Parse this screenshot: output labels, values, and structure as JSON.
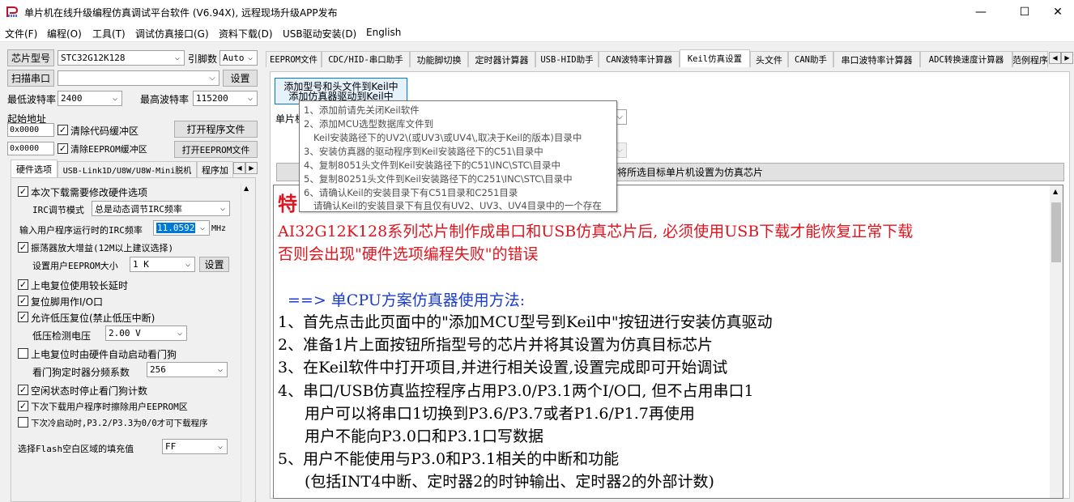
{
  "window": {
    "title": "单片机在线升级编程仿真调试平台软件 (V6.94X), 远程现场升级APP发布",
    "minimize": "—",
    "maximize": "☐",
    "close": "✕"
  },
  "menu": [
    "文件(F)",
    "编程(O)",
    "工具(T)",
    "调试仿真接口(G)",
    "资料下载(D)",
    "USB驱动安装(D)",
    "English"
  ],
  "left": {
    "chip_type_btn": "芯片型号",
    "chip_value": "STC32G12K128",
    "pin_label": "引脚数",
    "pin_value": "Auto",
    "scan_btn": "扫描串口",
    "port_value": "",
    "settings_btn": "设置",
    "min_baud_label": "最低波特率",
    "min_baud_value": "2400",
    "max_baud_label": "最高波特率",
    "max_baud_value": "115200",
    "start_addr_label": "起始地址",
    "addr1": "0x0000",
    "clear_code_label": "清除代码缓冲区",
    "open_prog_btn": "打开程序文件",
    "addr2": "0x0000",
    "clear_eeprom_label": "清除EEPROM缓冲区",
    "open_eeprom_btn": "打开EEPROM文件"
  },
  "left_tabs": [
    "硬件选项",
    "USB-Link1D/U8W/U8W-Mini脱机",
    "程序加"
  ],
  "hw": {
    "opt_modify": "本次下载需要修改硬件选项",
    "irc_mode_label": "IRC调节模式",
    "irc_mode_value": "总是动态调节IRC频率",
    "irc_freq_label": "输入用户程序运行时的IRC频率",
    "irc_freq_value": "11.0592",
    "irc_freq_unit": "MHz",
    "opt_osc_gain": "振荡器放大增益(12M以上建议选择)",
    "eeprom_size_label": "设置用户EEPROM大小",
    "eeprom_size_value": "1   K",
    "eeprom_set_btn": "设置",
    "opt_por_delay": "上电复位使用较长延时",
    "opt_reset_io": "复位脚用作I/O口",
    "opt_lvr": "允许低压复位(禁止低压中断)",
    "lvd_label": "低压检测电压",
    "lvd_value": "2.00 V",
    "opt_wdt_hw": "上电复位时由硬件自动启动看门狗",
    "wdt_div_label": "看门狗定时器分频系数",
    "wdt_div_value": "256",
    "opt_idle_wdt": "空闲状态时停止看门狗计数",
    "opt_erase_eeprom": "下次下载用户程序时擦除用户EEPROM区",
    "opt_cold_boot": "下次冷启动时,P3.2/P3.3为0/0才可下载程序",
    "flash_fill_label": "选择Flash空白区域的填充值",
    "flash_fill_value": "FF"
  },
  "right_tabs": [
    "EEPROM文件",
    "CDC/HID-串口助手",
    "功能脚切换",
    "定时器计算器",
    "USB-HID助手",
    "CAN波特率计算器",
    "Keil仿真设置",
    "头文件",
    "CAN助手",
    "串口波特率计算器",
    "ADC转换速度计算器",
    "范例程序"
  ],
  "keil": {
    "add_btn_line1": "添加型号和头文件到Keil中",
    "add_btn_line2": "添加仿真器驱动到Keil中",
    "chip_label_partial": "单片机",
    "set_chip_btn": "将所选目标单片机设置为仿真芯片"
  },
  "tooltip": [
    "1、添加前请先关闭Keil软件",
    "2、添加MCU选型数据库文件到",
    "Keil安装路径下的UV2\\(或UV3\\或UV4\\,取决于Keil的版本)目录中",
    "3、安装仿真器的驱动程序到Keil安装路径下的C51\\目录中",
    "4、复制8051头文件到Keil安装路径下的C51\\INC\\STC\\目录中",
    "5、复制80251头文件到Keil安装路径下的C251\\INC\\STC\\目录中",
    "6、请确认Keil的安装目录下有C51目录和C251目录",
    "请确认Keil的安装目录下有且仅有UV2、UV3、UV4目录中的一个存在"
  ],
  "content": {
    "heading_partial": "特",
    "red1": "AI32G12K128系列芯片制作成串口和USB仿真芯片后, 必须使用USB下载才能恢复正常下载",
    "red2": "否则会出现\"硬件选项编程失败\"的错误",
    "section": "==> 单CPU方案仿真器使用方法:",
    "lines": [
      "1、首先点击此页面中的\"添加MCU型号到Keil中\"按钮进行安装仿真驱动",
      "2、准备1片上面按钮所指型号的芯片并将其设置为仿真目标芯片",
      "3、在Keil软件中打开项目,并进行相关设置,设置完成即可开始调试",
      "4、串口/USB仿真监控程序占用P3.0/P3.1两个I/O口, 但不占用串口1",
      "用户可以将串口1切换到P3.6/P3.7或者P1.6/P1.7再使用",
      "用户不能向P3.0口和P3.1口写数据",
      "5、用户不能使用与P3.0和P3.1相关的中断和功能",
      "(包括INT4中断、定时器2的时钟输出、定时器2的外部计数)"
    ]
  },
  "colors": {
    "red": "#e0141e",
    "blue": "#1a3cd0",
    "highlight": "#0078d7"
  }
}
